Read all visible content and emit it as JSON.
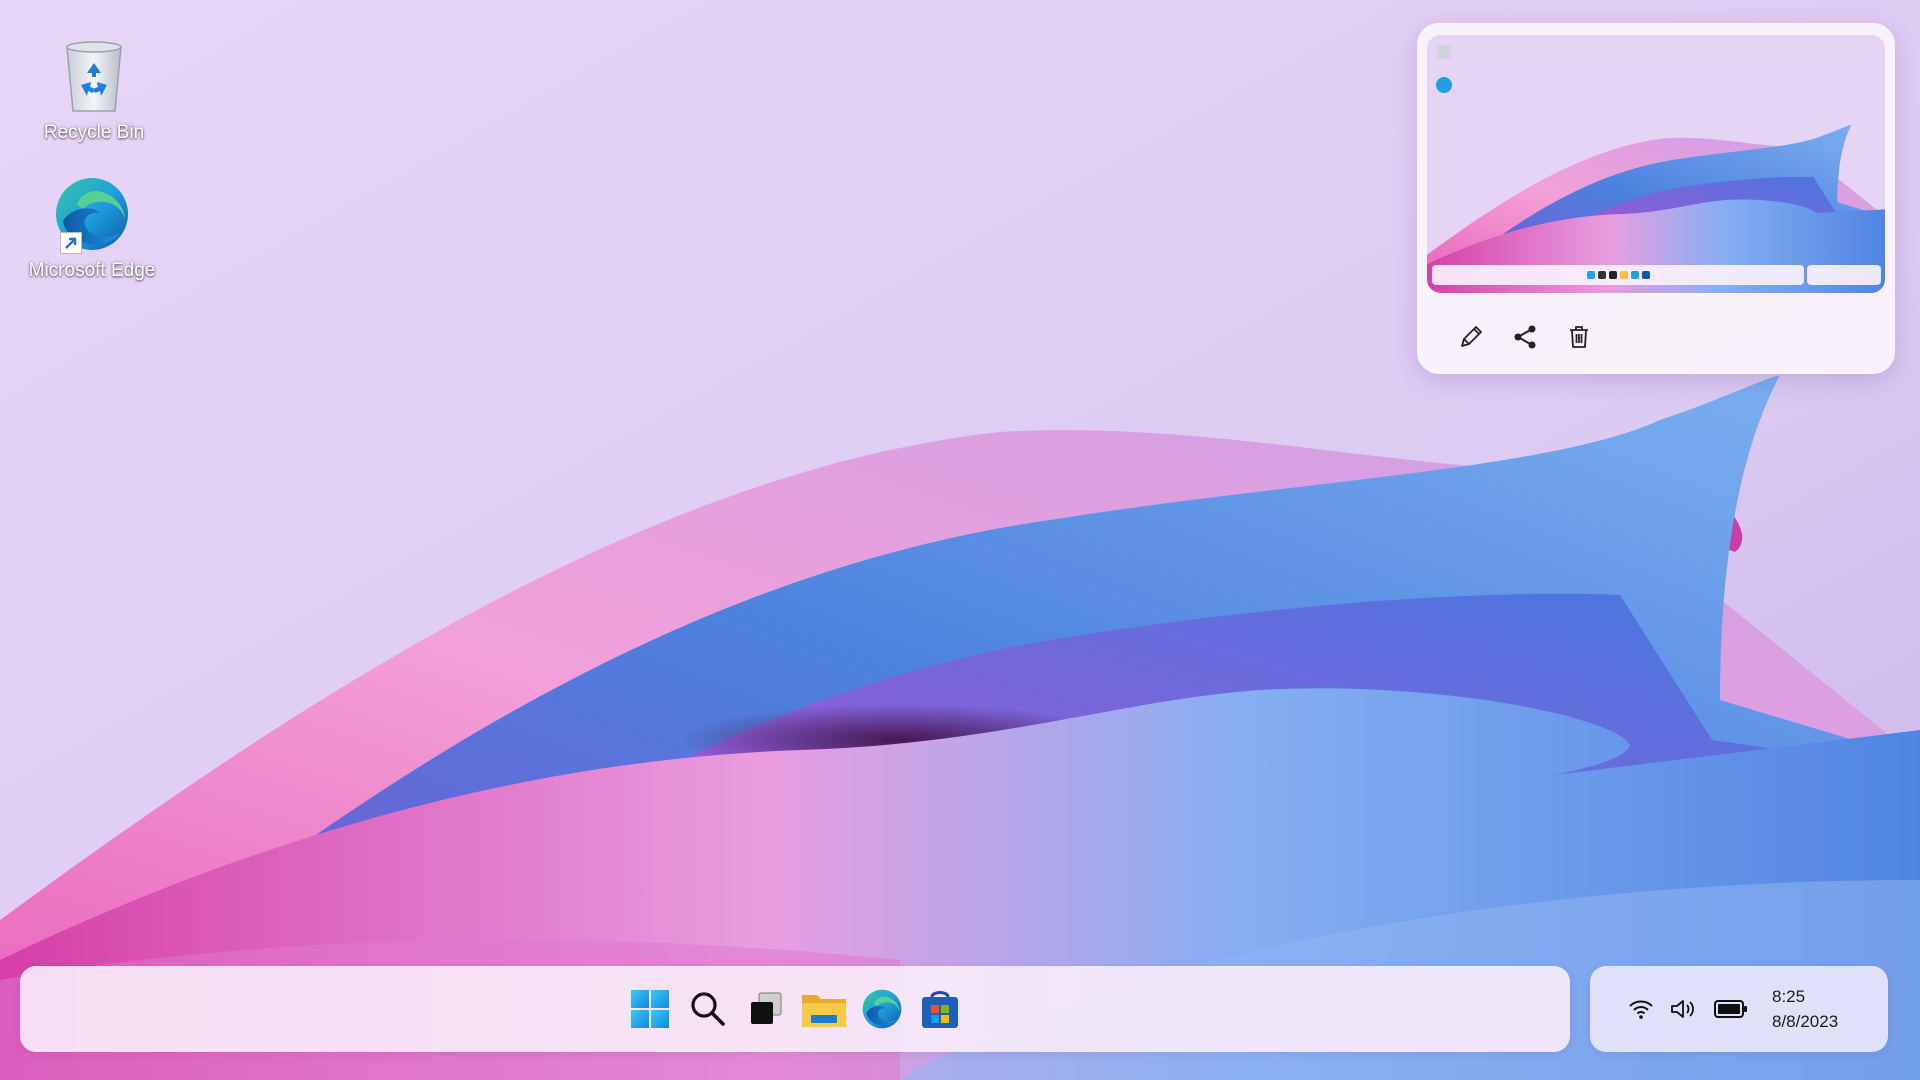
{
  "desktop": {
    "icons": [
      {
        "label": "Recycle Bin",
        "icon": "recycle-bin-icon"
      },
      {
        "label": "Microsoft Edge",
        "icon": "edge-icon",
        "shortcut": true
      }
    ]
  },
  "snip_preview": {
    "actions": [
      {
        "icon": "pencil-icon"
      },
      {
        "icon": "share-icon"
      },
      {
        "icon": "trash-icon"
      }
    ]
  },
  "taskbar": {
    "apps": [
      {
        "icon": "windows-start-icon"
      },
      {
        "icon": "search-icon"
      },
      {
        "icon": "task-view-icon"
      },
      {
        "icon": "file-explorer-icon"
      },
      {
        "icon": "edge-icon"
      },
      {
        "icon": "microsoft-store-icon"
      }
    ]
  },
  "tray": {
    "icons": [
      "wifi-icon",
      "volume-icon",
      "battery-icon"
    ],
    "time": "8:25",
    "date": "8/8/2023"
  },
  "colors": {
    "start_blue": "#1ea4f0",
    "edge_blue": "#0c59a4",
    "edge_green": "#40c36a",
    "folder_yellow": "#f5c143",
    "wallpaper_pink": "#f08acb",
    "wallpaper_blue": "#4a86e0",
    "wallpaper_lilac": "#e7d6f6"
  }
}
